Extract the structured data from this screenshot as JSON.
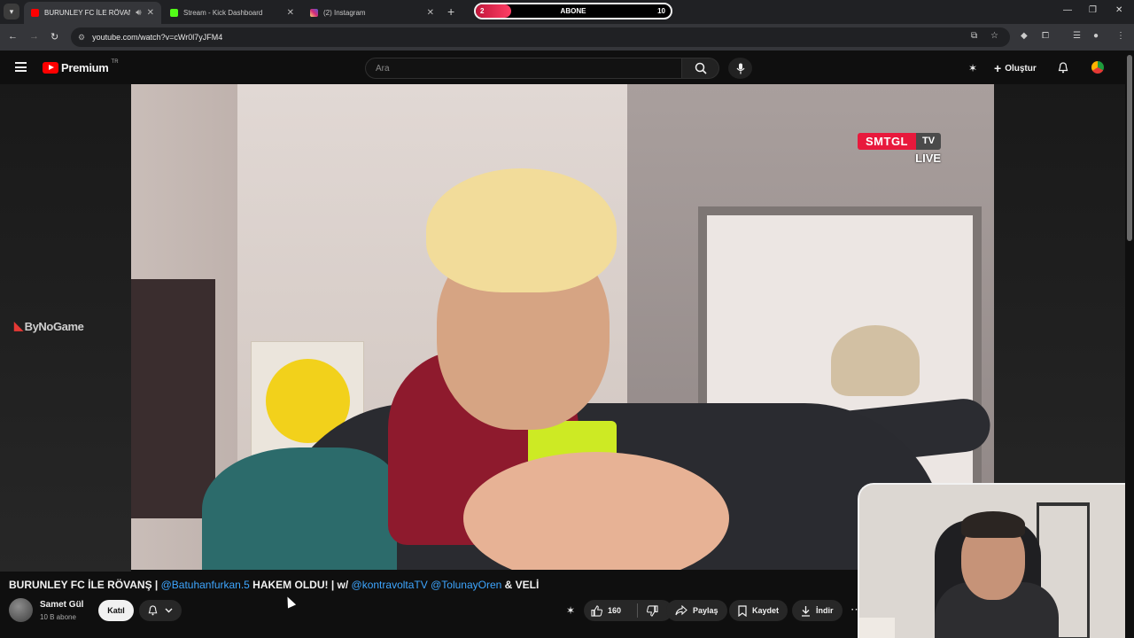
{
  "browser": {
    "tabs": [
      {
        "label": "BURUNLEY FC İLE RÖVANŞ",
        "favicon_color": "#ff0000",
        "active": true
      },
      {
        "label": "Stream - Kick Dashboard",
        "favicon_color": "#53fc18",
        "active": false
      },
      {
        "label": "(2) Instagram",
        "favicon_color": "#e1306c",
        "active": false
      }
    ],
    "subscriber_goal": {
      "start": "2",
      "label": "ABONE",
      "end": "10",
      "progress": 0.07,
      "fill_color": "#e8193c"
    },
    "url": "youtube.com/watch?v=cWr0l7yJFM4",
    "icons": [
      "back-icon",
      "forward-icon",
      "reload-icon",
      "tune-icon",
      "install-icon",
      "star-icon",
      "extension-icon",
      "puzzle-icon",
      "reading-list-icon",
      "profile-icon",
      "menu-kebab-icon"
    ]
  },
  "youtube": {
    "logo_text": "Premium",
    "country_code": "TR",
    "search_placeholder": "Ara",
    "create_label": "Oluştur",
    "brand_color": "#ff0000"
  },
  "video": {
    "overlay_brand": "SMTGL",
    "overlay_tv": "TV",
    "overlay_live": "LIVE",
    "side_watermark": "ByNoGame"
  },
  "meta": {
    "title_parts": [
      {
        "text": "BURUNLEY FC İLE RÖVANŞ | ",
        "mention": false
      },
      {
        "text": "@Batuhanfurkan.5",
        "mention": true
      },
      {
        "text": " HAKEM OLDU! | w/ ",
        "mention": false
      },
      {
        "text": "@kontravoltaTV",
        "mention": true
      },
      {
        "text": " ",
        "mention": false
      },
      {
        "text": "@TolunayOren",
        "mention": true
      },
      {
        "text": " & VELİ",
        "mention": false
      }
    ],
    "channel_name": "Samet Gül",
    "subscribers": "10 B abone",
    "join_label": "Katıl",
    "likes": "160",
    "share_label": "Paylaş",
    "save_label": "Kaydet",
    "download_label": "İndir",
    "mention_color": "#3ea6ff"
  }
}
